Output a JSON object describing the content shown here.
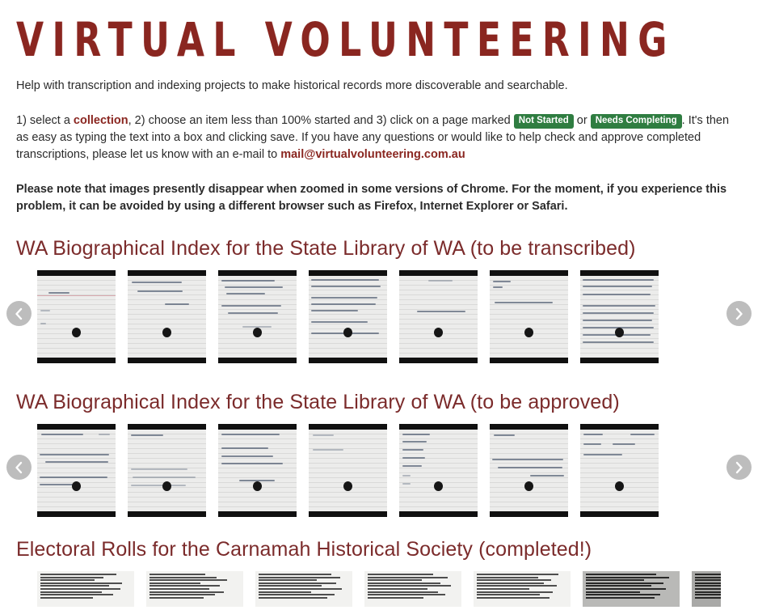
{
  "site": {
    "title": "VIRTUAL VOLUNTEERING",
    "title_color": "#8a2620"
  },
  "intro": {
    "lead": "Help with transcription and indexing projects to make historical records more discoverable and searchable.",
    "steps": {
      "part1": "1) select a ",
      "collection_link": "collection",
      "part2": ", 2) choose an item less than 100% started and 3) click on a page marked ",
      "badge_not_started": "Not Started",
      "part3": " or ",
      "badge_needs_completing": "Needs Completing",
      "part4": ". It's then as easy as typing the text into a box and clicking save. If you have any questions or would like to help check and approve completed transcriptions, please let us know with an e-mail to ",
      "email_link": "mail@virtualvolunteering.com.au"
    },
    "note": "Please note that images presently disappear when zoomed in some versions of Chrome. For the moment, if you experience this problem, it can be avoided by using a different browser such as Firefox, Internet Explorer or Safari.",
    "badge_color": "#2f7d41",
    "link_color": "#8a2620"
  },
  "sections": [
    {
      "id": "wa-bio-index-transcribe",
      "title": "WA Biographical Index for the State Library of WA (to be transcribed)",
      "prev_label": "Previous",
      "next_label": "Next",
      "thumb_type": "index-card",
      "thumbs": [
        {
          "name": "index-card-1"
        },
        {
          "name": "index-card-2"
        },
        {
          "name": "index-card-3"
        },
        {
          "name": "index-card-4"
        },
        {
          "name": "index-card-5"
        },
        {
          "name": "index-card-6"
        },
        {
          "name": "index-card-7"
        }
      ]
    },
    {
      "id": "wa-bio-index-approve",
      "title": "WA Biographical Index for the State Library of WA (to be approved)",
      "prev_label": "Previous",
      "next_label": "Next",
      "thumb_type": "index-card",
      "thumbs": [
        {
          "name": "index-card-1"
        },
        {
          "name": "index-card-2"
        },
        {
          "name": "index-card-3"
        },
        {
          "name": "index-card-4"
        },
        {
          "name": "index-card-5"
        },
        {
          "name": "index-card-6"
        },
        {
          "name": "index-card-7"
        }
      ]
    },
    {
      "id": "electoral-rolls-carnamah",
      "title": "Electoral Rolls for the Carnamah Historical Society (completed!)",
      "prev_label": "Previous",
      "next_label": "Next",
      "thumb_type": "electoral-roll",
      "thumbs": [
        {
          "name": "electoral-roll-1",
          "shade": "light"
        },
        {
          "name": "electoral-roll-2",
          "shade": "light"
        },
        {
          "name": "electoral-roll-3",
          "shade": "light"
        },
        {
          "name": "electoral-roll-4",
          "shade": "light"
        },
        {
          "name": "electoral-roll-5",
          "shade": "light"
        },
        {
          "name": "electoral-roll-6",
          "shade": "dark"
        },
        {
          "name": "electoral-roll-7",
          "shade": "darker"
        }
      ]
    }
  ]
}
